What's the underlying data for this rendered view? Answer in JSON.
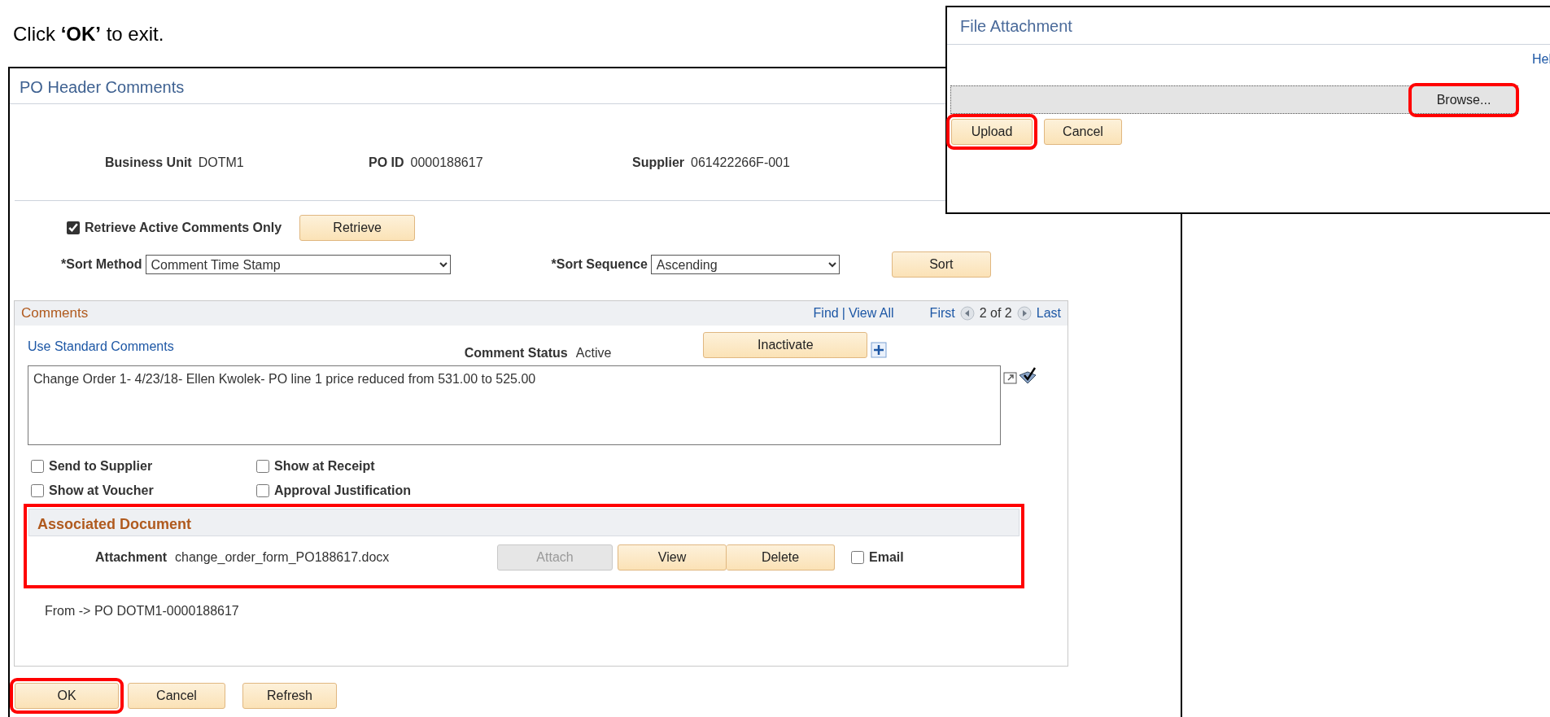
{
  "instruction": "Click **‘OK’** to exit.",
  "window": {
    "title": "PO Header Comments"
  },
  "header_fields": [
    {
      "label": "Business Unit",
      "value": "DOTM1"
    },
    {
      "label": "PO ID",
      "value": "0000188617"
    },
    {
      "label": "Supplier",
      "value": "061422266F-001"
    }
  ],
  "retrieve_active_only": {
    "label": "Retrieve Active Comments Only",
    "checked": true
  },
  "retrieve_button": "Retrieve",
  "sort_method": {
    "label": "*Sort Method",
    "value": "Comment Time Stamp"
  },
  "sort_sequence": {
    "label": "*Sort Sequence",
    "value": "Ascending"
  },
  "sort_button": "Sort",
  "comments": {
    "title": "Comments",
    "find": "Find",
    "separator": "|",
    "view_all": "View All",
    "first": "First",
    "position": "2 of 2",
    "last": "Last",
    "use_standard": "Use Standard Comments",
    "status_label": "Comment Status",
    "status_value": "Active",
    "inactivate": "Inactivate",
    "text": "Change Order 1- 4/23/18- Ellen Kwolek- PO line 1 price reduced from 531.00 to 525.00",
    "options": [
      {
        "label": "Send to Supplier",
        "checked": false
      },
      {
        "label": "Show at Receipt",
        "checked": false
      },
      {
        "label": "Show at Voucher",
        "checked": false
      },
      {
        "label": "Approval Justification",
        "checked": false
      }
    ],
    "associated_document": {
      "title": "Associated Document",
      "highlighted": true,
      "attachment_label": "Attachment",
      "file": "change_order_form_PO188617.docx",
      "buttons": [
        {
          "label": "Attach",
          "disabled": true
        },
        {
          "label": "View",
          "disabled": false
        },
        {
          "label": "Delete",
          "disabled": false
        }
      ],
      "email": {
        "label": "Email",
        "checked": false
      }
    },
    "origin": "From -> PO DOTM1-0000188617"
  },
  "buttons": [
    {
      "label": "OK",
      "highlighted": true
    },
    {
      "label": "Cancel",
      "highlighted": false
    },
    {
      "label": "Refresh",
      "highlighted": false
    }
  ],
  "file_attachment": {
    "title": "File Attachment",
    "help": "Hel",
    "browse": {
      "label": "Browse...",
      "highlighted": true
    },
    "buttons": [
      {
        "label": "Upload",
        "highlighted": true
      },
      {
        "label": "Cancel",
        "highlighted": false
      }
    ]
  }
}
